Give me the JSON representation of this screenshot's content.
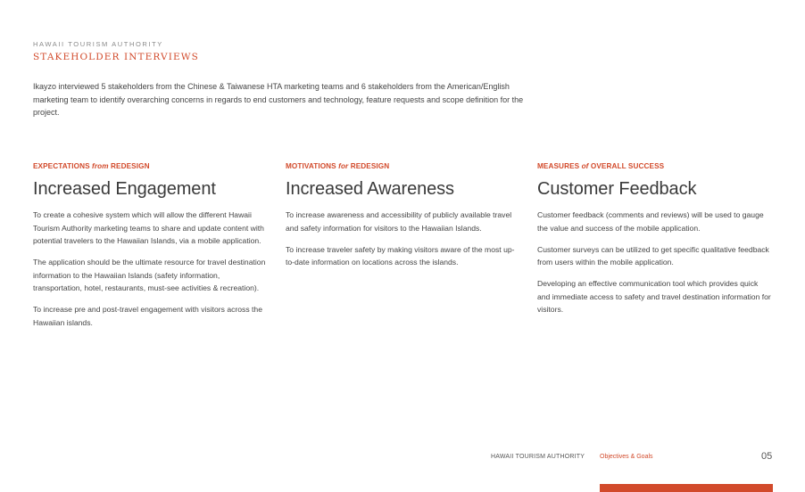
{
  "header": {
    "org": "HAWAII TOURISM AUTHORITY",
    "title": "STAKEHOLDER INTERVIEWS",
    "intro": "Ikayzo interviewed 5 stakeholders  from the Chinese & Taiwanese HTA marketing teams and 6 stakeholders from the American/English marketing team to identify overarching concerns in regards to end customers and technology, feature requests and scope definition for the project."
  },
  "columns": [
    {
      "eyebrow_pre": "EXPECTATIONS ",
      "eyebrow_em": "from",
      "eyebrow_post": " REDESIGN",
      "title": "Increased Engagement",
      "paragraphs": [
        "To create a cohesive system which will allow the different Hawaii Tourism Authority marketing teams to share and update content with potential travelers to the Hawaiian Islands, via a mobile application.",
        "The application should be the ultimate resource for travel destination information to the Hawaiian Islands (safety information, transportation, hotel, restaurants, must-see activities & recreation).",
        "To increase pre and post-travel engagement with visitors across the Hawaiian islands."
      ]
    },
    {
      "eyebrow_pre": "MOTIVATIONS ",
      "eyebrow_em": "for",
      "eyebrow_post": " REDESIGN",
      "title": "Increased Awareness",
      "paragraphs": [
        "To increase awareness and accessibility of publicly available travel and safety information for visitors to the Hawaiian Islands.",
        "To increase traveler safety by making visitors aware of the most up-to-date information on locations across the islands."
      ]
    },
    {
      "eyebrow_pre": "MEASURES ",
      "eyebrow_em": "of",
      "eyebrow_post": " OVERALL SUCCESS",
      "title": "Customer Feedback",
      "paragraphs": [
        "Customer feedback (comments and reviews) will be used to gauge the value and success of the mobile application.",
        "Customer surveys can be utilized to get specific qualitative feedback from users within the mobile application.",
        "Developing an effective communication tool which provides quick and immediate access to safety and travel destination information for visitors."
      ]
    }
  ],
  "footer": {
    "org": "HAWAII TOURISM AUTHORITY",
    "section": "Objectives & Goals",
    "page": "05"
  },
  "colors": {
    "accent": "#d24a2b",
    "text": "#444444"
  }
}
